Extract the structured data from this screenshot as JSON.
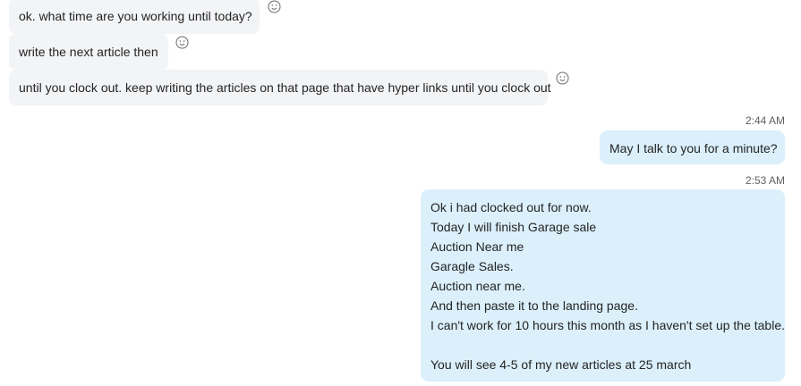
{
  "messages": {
    "incoming": [
      {
        "text": "ok. what time are you working until today?"
      },
      {
        "text": "write the next article then"
      },
      {
        "text": "until you clock out. keep writing the articles on that page that have hyper links until you clock out"
      }
    ],
    "outgoing": [
      {
        "time": "2:44 AM",
        "text": "May I talk to you for a minute?"
      },
      {
        "time": "2:53 AM",
        "lines": [
          "Ok i had clocked out for now.",
          "Today I will finish Garage sale",
          "Auction Near me",
          "Garagle Sales.",
          "Auction near me.",
          "And then paste it to the landing page.",
          "I can't work for 10 hours this month as I haven't set up the table.",
          "",
          "You will see 4-5 of my new articles at 25 march"
        ]
      }
    ]
  },
  "icons": {
    "reaction": "smiley-face-icon"
  },
  "colors": {
    "incoming_bubble": "#f3f4f6",
    "outgoing_bubble": "#dbf0fb",
    "timestamp": "#616161"
  }
}
